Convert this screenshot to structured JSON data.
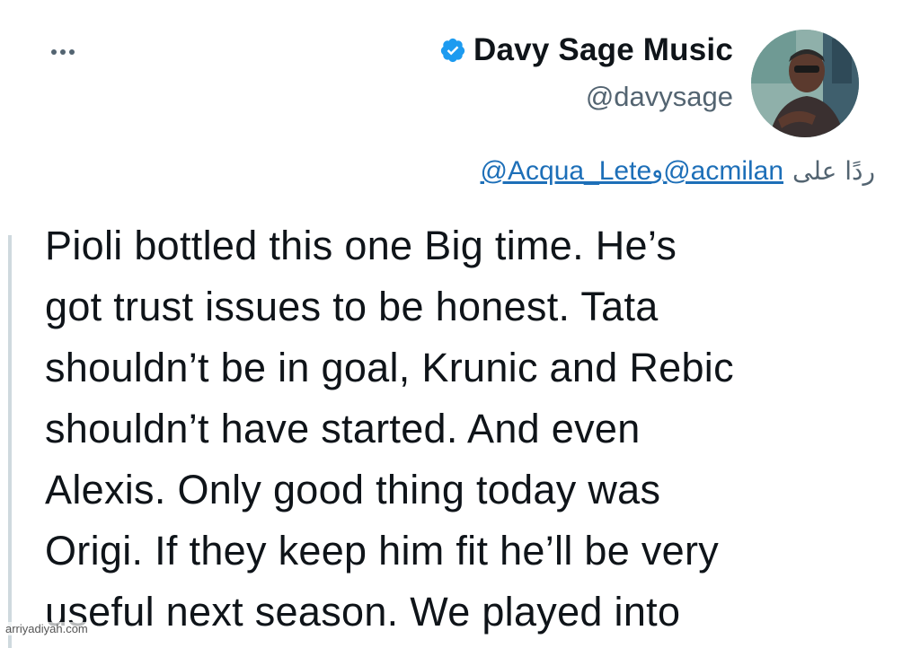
{
  "menu": {
    "more_icon": "more-horizontal-icon"
  },
  "author": {
    "display_name": "Davy Sage Music",
    "handle": "@davysage",
    "verified_icon": "verified-badge-icon",
    "verified_color": "#1d9bf0"
  },
  "reply": {
    "prefix": "ردًا على",
    "mention_1": "@acmilan",
    "conjunction": "و",
    "mention_2": "@Acqua_Lete"
  },
  "tweet": {
    "lines": [
      "Pioli bottled this one Big time. He’s",
      "got trust issues to be honest. Tata",
      "shouldn’t be in goal, Krunic and Rebic",
      "shouldn’t have started. And even",
      "Alexis. Only good thing today was",
      "Origi. If they keep him fit he’ll be very",
      "useful next season. We played into"
    ]
  },
  "watermark": "arriyadiyah.com",
  "colors": {
    "link": "#1d6fb8",
    "secondary_text": "#536471",
    "text": "#0f1419"
  }
}
